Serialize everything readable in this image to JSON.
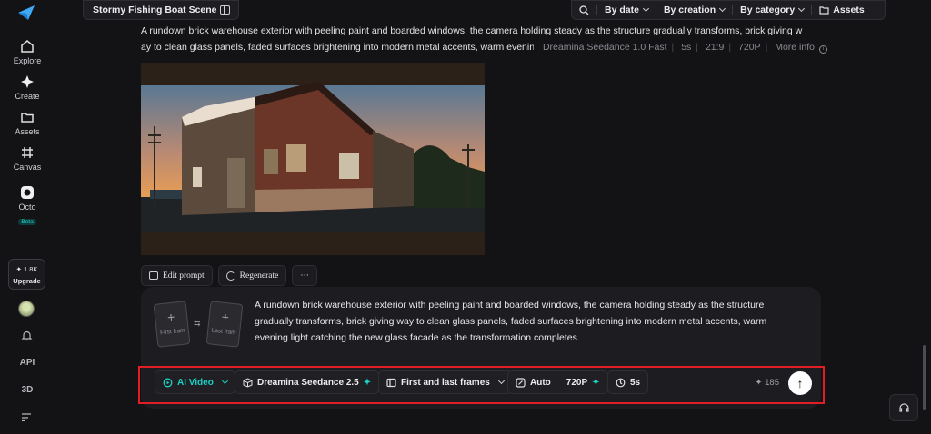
{
  "sidebar": {
    "items": [
      {
        "label": "Explore",
        "icon": "home-icon"
      },
      {
        "label": "Create",
        "icon": "sparkle-icon"
      },
      {
        "label": "Assets",
        "icon": "folder-icon"
      },
      {
        "label": "Canvas",
        "icon": "canvas-icon"
      },
      {
        "label": "Octo",
        "icon": "octo-icon",
        "badge": "Beta"
      }
    ],
    "upgrade": {
      "credits": "1.8K",
      "label": "Upgrade"
    },
    "api_label": "API",
    "threed_label": "3D"
  },
  "topbar": {
    "title": "Stormy Fishing Boat Scene",
    "filters": {
      "by_date": "By date",
      "by_creation": "By creation",
      "by_category": "By category",
      "assets": "Assets"
    }
  },
  "feed_item": {
    "description_line1": "A rundown brick warehouse exterior with peeling paint and boarded windows, the camera holding steady as the structure gradually transforms, brick giving w",
    "description_line2": "ay to clean glass panels, faded surfaces brightening into modern metal accents, warm evening",
    "meta": {
      "model": "Dreamina Seedance 1.0 Fast",
      "duration": "5s",
      "ratio": "21:9",
      "resolution": "720P",
      "more_info": "More info"
    },
    "actions": {
      "edit": "Edit prompt",
      "regenerate": "Regenerate",
      "more": "···"
    }
  },
  "prompt_panel": {
    "first_frame": "First fram",
    "last_frame": "Last fram",
    "text": "A rundown brick warehouse exterior with peeling paint and boarded windows, the camera holding steady as the structure gradually transforms, brick giving way to clean glass panels, faded surfaces brightening into modern metal accents, warm evening light catching the new glass facade as the transformation completes."
  },
  "toolbar": {
    "mode": "AI Video",
    "model": "Dreamina Seedance 2.5",
    "frames": "First and last frames",
    "aspect": "Auto",
    "resolution": "720P",
    "duration": "5s",
    "credits": "185"
  },
  "colors": {
    "accent": "#1ad1c4",
    "highlight": "#e01e24",
    "background": "#131316"
  }
}
